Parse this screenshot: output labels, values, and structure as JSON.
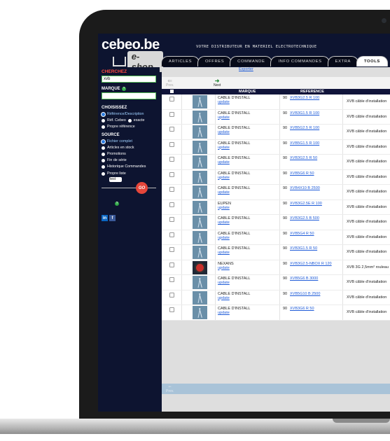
{
  "header": {
    "logo_top": "cebeo.be",
    "logo_bottom": "e-shop",
    "tagline": "VOTRE DISTRIBUTEUR EN MATERIEL ELECTROTECHNIQUE",
    "tabs": [
      {
        "label": "ARTICLES",
        "active": false
      },
      {
        "label": "OFFRES",
        "active": false
      },
      {
        "label": "COMMANDE",
        "active": false
      },
      {
        "label": "INFO COMMANDES",
        "active": false
      },
      {
        "label": "EXTRA",
        "active": false
      },
      {
        "label": "TOOLS",
        "active": true
      }
    ]
  },
  "sidebar": {
    "search_title": "CHERCHEZ",
    "search_value": "xvb",
    "marque_label": "MARQUE",
    "marque_value": "",
    "choisissez_label": "CHOISISSEZ",
    "options": [
      {
        "label": "Référence/Description",
        "selected": true
      },
      {
        "label": "Réf. Cebeo",
        "selected": false
      },
      {
        "label": "exacte",
        "selected": false
      },
      {
        "label": "Propre référence",
        "selected": false
      }
    ],
    "source_label": "SOURCE",
    "sources": [
      {
        "label": "Fichier complet",
        "selected": true
      },
      {
        "label": "Articles en stock",
        "selected": false
      },
      {
        "label": "Promotions",
        "selected": false
      },
      {
        "label": "Fin de série",
        "selected": false
      },
      {
        "label": "Historique Commandes",
        "selected": false
      },
      {
        "label": "Propre liste",
        "selected": false
      }
    ],
    "liste_select": "test",
    "go_label": "GO",
    "social": [
      "in",
      "f"
    ]
  },
  "content": {
    "export_label": "Exporter",
    "prev_label": "Prev.",
    "next_label": "Next",
    "prev_bottom_label": "Prev.",
    "columns": {
      "marque": "MARQUE",
      "reference": "REFERENCE"
    },
    "rows": [
      {
        "brand": "CABLE D'INSTALL",
        "link": "update",
        "qty": "90",
        "ref": "XVB3G2.5 R 100",
        "desc": "XVB câble d'installation",
        "thumb": "cable"
      },
      {
        "brand": "CABLE D'INSTALL",
        "link": "update",
        "qty": "90",
        "ref": "XVB3G1.5 R 100",
        "desc": "XVB câble d'installation",
        "thumb": "cable"
      },
      {
        "brand": "CABLE D'INSTALL",
        "link": "update",
        "qty": "90",
        "ref": "XVB5G2.5 R 100",
        "desc": "XVB câble d'installation",
        "thumb": "cable"
      },
      {
        "brand": "CABLE D'INSTALL",
        "link": "update",
        "qty": "90",
        "ref": "XVB5G1.5 R 100",
        "desc": "XVB câble d'installation",
        "thumb": "cable"
      },
      {
        "brand": "CABLE D'INSTALL",
        "link": "update",
        "qty": "90",
        "ref": "XVB3G2.5 R 50",
        "desc": "XVB câble d'installation",
        "thumb": "cable"
      },
      {
        "brand": "CABLE D'INSTALL",
        "link": "update",
        "qty": "90",
        "ref": "XVB5G6 R 50",
        "desc": "XVB câble d'installation",
        "thumb": "cable"
      },
      {
        "brand": "CABLE D'INSTALL",
        "link": "update",
        "qty": "90",
        "ref": "XVB4X10 B 2500",
        "desc": "XVB câble d'installation",
        "thumb": "cable"
      },
      {
        "brand": "EUPEN",
        "link": "update",
        "qty": "90",
        "ref": "XVB3G2.5E R 100",
        "desc": "XVB câble d'installation",
        "thumb": "cable"
      },
      {
        "brand": "CABLE D'INSTALL",
        "link": "update",
        "qty": "90",
        "ref": "XVB3G2.5 B 500",
        "desc": "XVB câble d'installation",
        "thumb": "cable"
      },
      {
        "brand": "CABLE D'INSTALL",
        "link": "update",
        "qty": "90",
        "ref": "XVB5G4 R 50",
        "desc": "XVB câble d'installation",
        "thumb": "cable"
      },
      {
        "brand": "CABLE D'INSTALL",
        "link": "update",
        "qty": "90",
        "ref": "XVB3G1.5 R 50",
        "desc": "XVB câble d'installation",
        "thumb": "cable"
      },
      {
        "brand": "NEXANS",
        "link": "update",
        "qty": "90",
        "ref": "XVB3G2.5-NBOX R 120",
        "desc": "XVB 3G 2,5mm² rouleau",
        "thumb": "dark"
      },
      {
        "brand": "CABLE D'INSTALL",
        "link": "update",
        "qty": "90",
        "ref": "XVB5G6 B 3000",
        "desc": "XVB câble d'installation",
        "thumb": "cable"
      },
      {
        "brand": "CABLE D'INSTALL",
        "link": "update",
        "qty": "90",
        "ref": "XVB5G10 B 2500",
        "desc": "XVB câble d'installation",
        "thumb": "cable"
      },
      {
        "brand": "CABLE D'INSTALL",
        "link": "update",
        "qty": "90",
        "ref": "XVB3G6 R 50",
        "desc": "XVB câble d'installation",
        "thumb": "cable"
      }
    ]
  }
}
